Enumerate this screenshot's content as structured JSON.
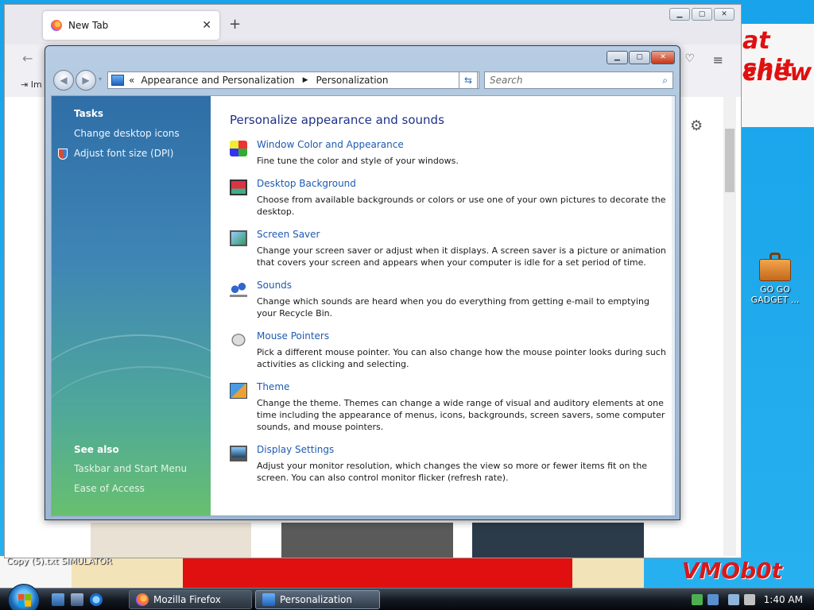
{
  "desktop": {
    "paint_line1": "at shit",
    "paint_line2": "chew",
    "icon_label": "GO GO GADGET ...",
    "bottom_label": "Copy (5).txt    SIMULATOR",
    "watermark": "VMOb0t"
  },
  "firefox": {
    "tab_title": "New Tab",
    "bookmark_text": "Im",
    "newtab_symbol": "+",
    "close_symbol": "✕"
  },
  "cp": {
    "breadcrumb": {
      "prefix": "«",
      "part1": "Appearance and Personalization",
      "part2": "Personalization"
    },
    "search_placeholder": "Search",
    "tasks": {
      "title": "Tasks",
      "items": [
        "Change desktop icons",
        "Adjust font size (DPI)"
      ]
    },
    "see_also": {
      "title": "See also",
      "items": [
        "Taskbar and Start Menu",
        "Ease of Access"
      ]
    },
    "heading": "Personalize appearance and sounds",
    "items": [
      {
        "icon": "window-color-icon",
        "title": "Window Color and Appearance",
        "desc": "Fine tune the color and style of your windows."
      },
      {
        "icon": "desktop-background-icon",
        "title": "Desktop Background",
        "desc": "Choose from available backgrounds or colors or use one of your own pictures to decorate the desktop."
      },
      {
        "icon": "screen-saver-icon",
        "title": "Screen Saver",
        "desc": "Change your screen saver or adjust when it displays. A screen saver is a picture or animation that covers your screen and appears when your computer is idle for a set period of time."
      },
      {
        "icon": "sounds-icon",
        "title": "Sounds",
        "desc": "Change which sounds are heard when you do everything from getting e-mail to emptying your Recycle Bin."
      },
      {
        "icon": "mouse-pointers-icon",
        "title": "Mouse Pointers",
        "desc": "Pick a different mouse pointer. You can also change how the mouse pointer looks during such activities as clicking and selecting."
      },
      {
        "icon": "theme-icon",
        "title": "Theme",
        "desc": "Change the theme. Themes can change a wide range of visual and auditory elements at one time including the appearance of menus, icons, backgrounds, screen savers, some computer sounds, and mouse pointers."
      },
      {
        "icon": "display-settings-icon",
        "title": "Display Settings",
        "desc": "Adjust your monitor resolution, which changes the view so more or fewer items fit on the screen. You can also control monitor flicker (refresh rate)."
      }
    ]
  },
  "taskbar": {
    "buttons": [
      "Mozilla Firefox",
      "Personalization"
    ],
    "clock": "1:40 AM"
  },
  "colors": {
    "link_blue": "#1e5bb2",
    "heading_blue": "#1e3287",
    "desktop_blue": "#1aa0e8"
  }
}
